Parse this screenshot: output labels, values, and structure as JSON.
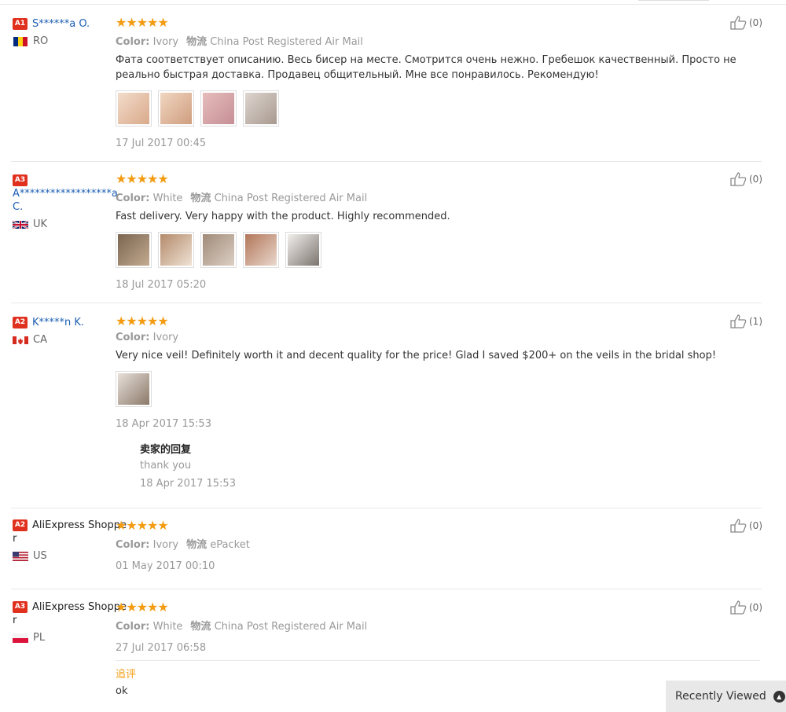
{
  "reviews": [
    {
      "level": "A1",
      "name": "S******a O.",
      "country": "RO",
      "stars": "★★★★★",
      "color_label": "Color:",
      "color": "Ivory",
      "ship_label": "物流",
      "shipping": "China Post Registered Air Mail",
      "text": "Фата соответствует описанию. Весь бисер на месте. Смотрится очень нежно. Гребешок качественный. Просто не реально быстрая доставка. Продавец общительный. Мне все понравилось. Рекомендую!",
      "date": "17 Jul 2017 00:45",
      "likes": "(0)",
      "thumbs": [
        "#e9c5aa",
        "#e8c4a8",
        "#d9a7a7",
        "#cfc5bf"
      ]
    },
    {
      "level": "A3",
      "name": "A******************a C.",
      "country": "UK",
      "stars": "★★★★★",
      "color_label": "Color:",
      "color": "White",
      "ship_label": "物流",
      "shipping": "China Post Registered Air Mail",
      "text": "Fast delivery. Very happy with the product. Highly recommended.",
      "date": "18 Jul 2017 05:20",
      "likes": "(0)",
      "thumbs": [
        "#8e7860",
        "#c9a88d",
        "#b9a597",
        "#c4977c",
        "#8f8a85"
      ]
    },
    {
      "level": "A2",
      "name": "K*****n K.",
      "country": "CA",
      "stars": "★★★★★",
      "color_label": "Color:",
      "color": "Ivory",
      "text": "Very nice veil! Definitely worth it and decent quality for the price! Glad I saved $200+ on the veils in the bridal shop!",
      "date": "18 Apr 2017 15:53",
      "likes": "(1)",
      "thumbs": [
        "#a69484"
      ],
      "reply_title": "卖家的回复",
      "reply_text": "thank you",
      "reply_date": "18 Apr 2017 15:53"
    },
    {
      "level": "A2",
      "name": "AliExpress Shopper",
      "country": "US",
      "stars": "★★★★★",
      "color_label": "Color:",
      "color": "Ivory",
      "ship_label": "物流",
      "shipping": "ePacket",
      "date": "01 May 2017 00:10",
      "likes": "(0)"
    },
    {
      "level": "A3",
      "name": "AliExpress Shopper",
      "country": "PL",
      "stars": "★★★★★",
      "color_label": "Color:",
      "color": "White",
      "ship_label": "物流",
      "shipping": "China Post Registered Air Mail",
      "date": "27 Jul 2017 06:58",
      "likes": "(0)",
      "addl_title": "追评",
      "addl_text": "ok"
    }
  ],
  "recently_viewed": "Recently Viewed",
  "colors": {
    "star": "#f39c12",
    "level_badge": "#e0301e",
    "username": "#1d5fb4"
  }
}
